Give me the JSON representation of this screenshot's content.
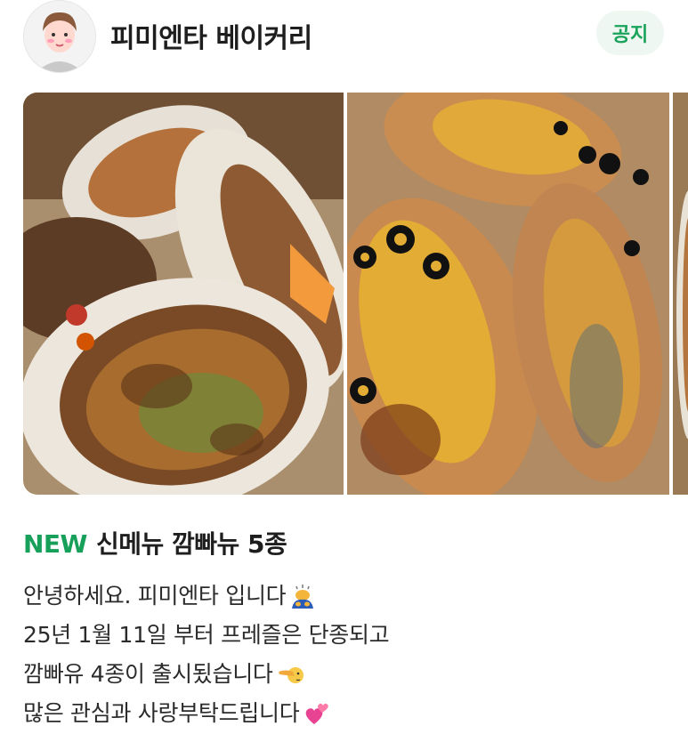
{
  "header": {
    "store_name": "피미엔타 베이커리",
    "notice_label": "공지"
  },
  "gallery": {
    "photos": [
      {
        "icon": "bread-photo-icon",
        "description_name": "photo-1"
      },
      {
        "icon": "bread-photo-icon",
        "description_name": "photo-2"
      },
      {
        "icon": "bread-photo-icon",
        "description_name": "photo-3"
      }
    ]
  },
  "post": {
    "title_badge": "NEW",
    "title_text": "신메뉴 깜빠뉴 5종",
    "lines": [
      {
        "text": "안녕하세요. 피미엔타 입니다",
        "emoji": "bowing-person-icon"
      },
      {
        "text": "25년 1월 11일 부터 프레즐은 단종되고",
        "emoji": ""
      },
      {
        "text": "깜빠유 4종이 출시됬습니다",
        "emoji": "pointing-finger-icon"
      },
      {
        "text": "많은 관심과 사랑부탁드립니다",
        "emoji": "two-hearts-icon"
      }
    ]
  },
  "colors": {
    "accent_green": "#16a05a",
    "notice_bg": "#eef7f1"
  }
}
